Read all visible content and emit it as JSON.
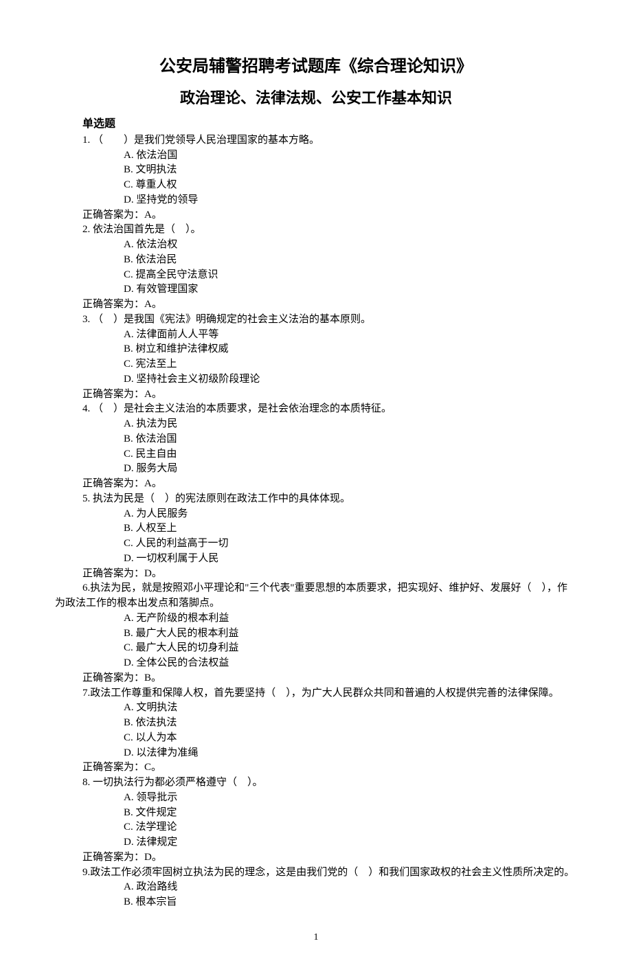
{
  "title1": "公安局辅警招聘考试题库《综合理论知识》",
  "title2": "政治理论、法律法规、公安工作基本知识",
  "section_heading": "单选题",
  "answer_label_prefix": "正确答案为：",
  "answer_label_suffix": "。",
  "page_number": "1",
  "questions": [
    {
      "num": "1.",
      "stem": "（　　）是我们党领导人民治理国家的基本方略。",
      "options": [
        {
          "letter": "A.",
          "text": "依法治国"
        },
        {
          "letter": "B.",
          "text": "文明执法"
        },
        {
          "letter": "C.",
          "text": "尊重人权"
        },
        {
          "letter": "D.",
          "text": "坚持党的领导"
        }
      ],
      "answer": "A"
    },
    {
      "num": "2.",
      "stem": "依法治国首先是（　）。",
      "options": [
        {
          "letter": "A.",
          "text": "依法治权"
        },
        {
          "letter": "B.",
          "text": "依法治民"
        },
        {
          "letter": "C.",
          "text": "提高全民守法意识"
        },
        {
          "letter": "D.",
          "text": "有效管理国家"
        }
      ],
      "answer": "A"
    },
    {
      "num": "3.",
      "stem": "（　）是我国《宪法》明确规定的社会主义法治的基本原则。",
      "options": [
        {
          "letter": "A.",
          "text": "法律面前人人平等"
        },
        {
          "letter": "B.",
          "text": "树立和维护法律权威"
        },
        {
          "letter": "C.",
          "text": "宪法至上"
        },
        {
          "letter": "D.",
          "text": "坚持社会主义初级阶段理论"
        }
      ],
      "answer": "A"
    },
    {
      "num": "4.",
      "stem": "（　）是社会主义法治的本质要求，是社会依治理念的本质特征。",
      "options": [
        {
          "letter": "A.",
          "text": "执法为民"
        },
        {
          "letter": "B.",
          "text": "依法治国"
        },
        {
          "letter": "C.",
          "text": "民主自由"
        },
        {
          "letter": "D.",
          "text": "服务大局"
        }
      ],
      "answer": "A"
    },
    {
      "num": "5.",
      "stem": "执法为民是（　）的宪法原则在政法工作中的具体体现。",
      "options": [
        {
          "letter": "A.",
          "text": "为人民服务"
        },
        {
          "letter": "B.",
          "text": "人权至上"
        },
        {
          "letter": "C.",
          "text": "人民的利益高于一切"
        },
        {
          "letter": "D.",
          "text": "一切权利属于人民"
        }
      ],
      "answer": "D"
    },
    {
      "num": "6.",
      "stem_wrap": "执法为民，就是按照邓小平理论和\"三个代表\"重要思想的本质要求，把实现好、维护好、发展好（　），作为政法工作的根本出发点和落脚点。",
      "options": [
        {
          "letter": "A.",
          "text": "无产阶级的根本利益"
        },
        {
          "letter": "B.",
          "text": "最广大人民的根本利益"
        },
        {
          "letter": "C.",
          "text": "最广大人民的切身利益"
        },
        {
          "letter": "D.",
          "text": "全体公民的合法权益"
        }
      ],
      "answer": "B"
    },
    {
      "num": "7.",
      "stem_wrap": "政法工作尊重和保障人权，首先要坚持（　），为广大人民群众共同和普遍的人权提供完善的法律保障。",
      "options": [
        {
          "letter": "A.",
          "text": "文明执法"
        },
        {
          "letter": "B.",
          "text": "依法执法"
        },
        {
          "letter": "C.",
          "text": "以人为本"
        },
        {
          "letter": "D.",
          "text": "以法律为准绳"
        }
      ],
      "answer": "C"
    },
    {
      "num": "8.",
      "stem": "一切执法行为都必须严格遵守（　）。",
      "options": [
        {
          "letter": "A.",
          "text": "领导批示"
        },
        {
          "letter": "B.",
          "text": "文件规定"
        },
        {
          "letter": "C.",
          "text": "法学理论"
        },
        {
          "letter": "D.",
          "text": "法律规定"
        }
      ],
      "answer": "D"
    },
    {
      "num": "9.",
      "stem_wrap": "政法工作必须牢固树立执法为民的理念，这是由我们党的（　）和我们国家政权的社会主义性质所决定的。",
      "options": [
        {
          "letter": "A.",
          "text": "政治路线"
        },
        {
          "letter": "B.",
          "text": "根本宗旨"
        }
      ],
      "answer": null
    }
  ]
}
